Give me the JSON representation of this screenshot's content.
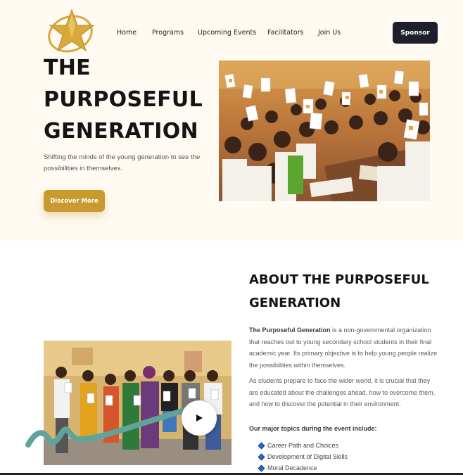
{
  "header": {
    "logo_icon": "gold-star-logo-icon",
    "nav": [
      {
        "label": "Home"
      },
      {
        "label": "Programs"
      },
      {
        "label": "Upcoming Events"
      },
      {
        "label": "Facilitators"
      },
      {
        "label": "Join Us"
      }
    ],
    "sponsor_label": "Sponsor"
  },
  "hero": {
    "title_lines": [
      "THE",
      "PURPOSEFUL",
      "GENERATION"
    ],
    "subtitle": "Shifting the minds of the young generation to see the possibilities in themselves.",
    "cta_label": "Discover More"
  },
  "about": {
    "title_lines": [
      "ABOUT THE PURPOSEFUL",
      "GENERATION"
    ],
    "p1_bold": "The Purposeful Generation",
    "p1_rest": " is a non-governmental organization that reaches out to young secondary school students in their final academic year. Its primary objective is to help young people realize the possibilities within themselves.",
    "p2": "As students prepare to face the wider world, it is crucial that they are educated about the challenges ahead, how to overcome them, and how to discover the potential in their environment.",
    "topics_heading": "Our major topics during the event include:",
    "topics": [
      {
        "label": "Career Path and Choices"
      },
      {
        "label": "Development of Digital Skills"
      },
      {
        "label": "Moral Decadence"
      }
    ]
  },
  "colors": {
    "accent_gold": "#c99a2e",
    "dark": "#1f1f2b",
    "hero_bg": "#fffaf2",
    "bullet_blue": "#1e6fd6",
    "squiggle_teal": "#5fa39a"
  }
}
